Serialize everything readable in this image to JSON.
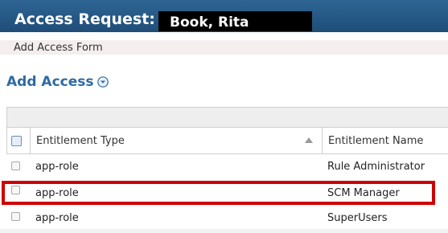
{
  "header": {
    "title": "Access Request:",
    "requestee": "Book, Rita"
  },
  "subheader": {
    "label": "Add Access Form"
  },
  "section": {
    "title": "Add Access",
    "icon": "chevron-down-circle-icon"
  },
  "table": {
    "columns": [
      "Entitlement Type",
      "Entitlement Name"
    ],
    "rows": [
      {
        "type": "app-role",
        "name": "Rule Administrator"
      },
      {
        "type": "app-role",
        "name": "SCM Manager"
      },
      {
        "type": "app-role",
        "name": "SuperUsers"
      }
    ]
  },
  "colors": {
    "titlebar": "#1f4e78",
    "section_title": "#2f6aa3",
    "highlight": "#d00000"
  }
}
